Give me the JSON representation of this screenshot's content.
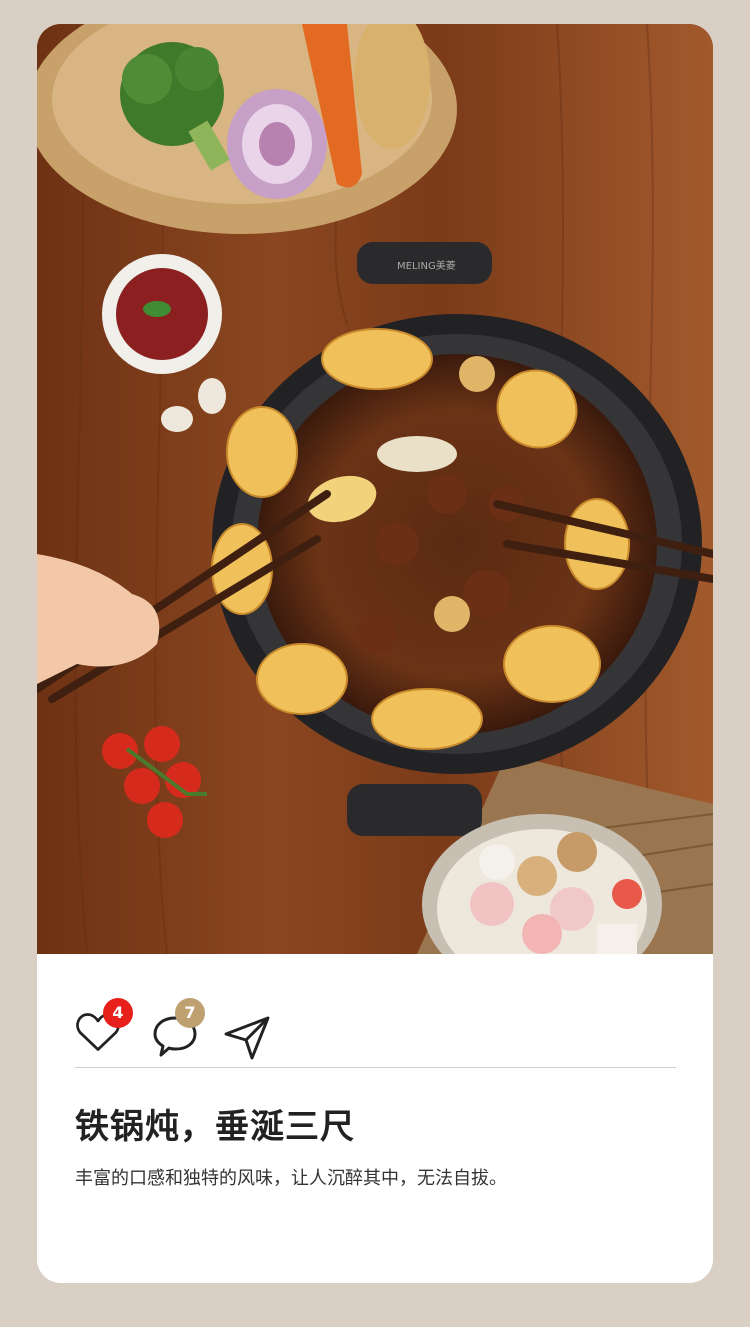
{
  "photo": {
    "description_icon": "hotpot-photo",
    "pot_brand": "MELING美菱"
  },
  "actions": {
    "like_icon": "heart-icon",
    "like_count": "4",
    "comment_icon": "comment-icon",
    "comment_count": "7",
    "share_icon": "send-icon"
  },
  "post": {
    "title": "铁锅炖，垂涎三尺",
    "description": "丰富的口感和独特的风味，让人沉醉其中，无法自拔。"
  },
  "colors": {
    "like_badge": "#e8201c",
    "comment_badge": "#bea071",
    "page_background": "#d9cfc4"
  }
}
